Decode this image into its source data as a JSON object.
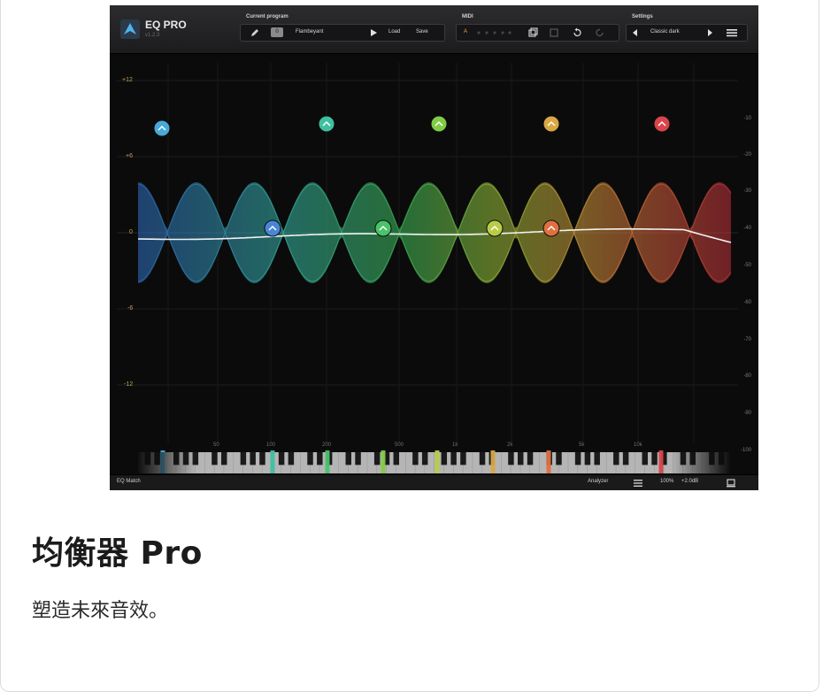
{
  "app": {
    "name": "EQ PRO",
    "version": "v1.2.3"
  },
  "toolbar": {
    "current_program_label": "Current program",
    "program_name": "Flambeyant",
    "program_index": "0",
    "load_label": "Load",
    "save_label": "Save",
    "midi_label": "MIDI",
    "midi_value": "A",
    "settings_label": "Settings",
    "theme_name": "Classic dark"
  },
  "gain_labels": [
    "+12",
    "+6",
    "0",
    "-6",
    "-12"
  ],
  "db_labels": [
    "-10",
    "-20",
    "-30",
    "-40",
    "-50",
    "-60",
    "-70",
    "-80",
    "-90",
    "-100"
  ],
  "freq_labels": [
    "50",
    "100",
    "200",
    "500",
    "1k",
    "2k",
    "5k",
    "10k"
  ],
  "bands": [
    {
      "id": 1,
      "color": "#4a86d8",
      "icon": "low-shelf-icon"
    },
    {
      "id": 2,
      "color": "#4aa8d8",
      "icon": "bell-icon"
    },
    {
      "id": 3,
      "color": "#3fc0a0",
      "icon": "bell-icon"
    },
    {
      "id": 4,
      "color": "#49c46a",
      "icon": "bell-icon"
    },
    {
      "id": 5,
      "color": "#7fcc47",
      "icon": "bell-icon"
    },
    {
      "id": 6,
      "color": "#b9cc45",
      "icon": "bell-icon"
    },
    {
      "id": 7,
      "color": "#d9a845",
      "icon": "bell-icon"
    },
    {
      "id": 8,
      "color": "#e07040",
      "icon": "high-shelf-icon"
    },
    {
      "id": 9,
      "color": "#d9454a",
      "icon": "bell-icon"
    }
  ],
  "bottom": {
    "left_label": "EQ Match",
    "analyzer_label": "Analyzer",
    "zoom": "100%",
    "gain_readout": "+2.0dB"
  },
  "caption": {
    "title": "均衡器 Pro",
    "subtitle": "塑造未來音效。"
  }
}
